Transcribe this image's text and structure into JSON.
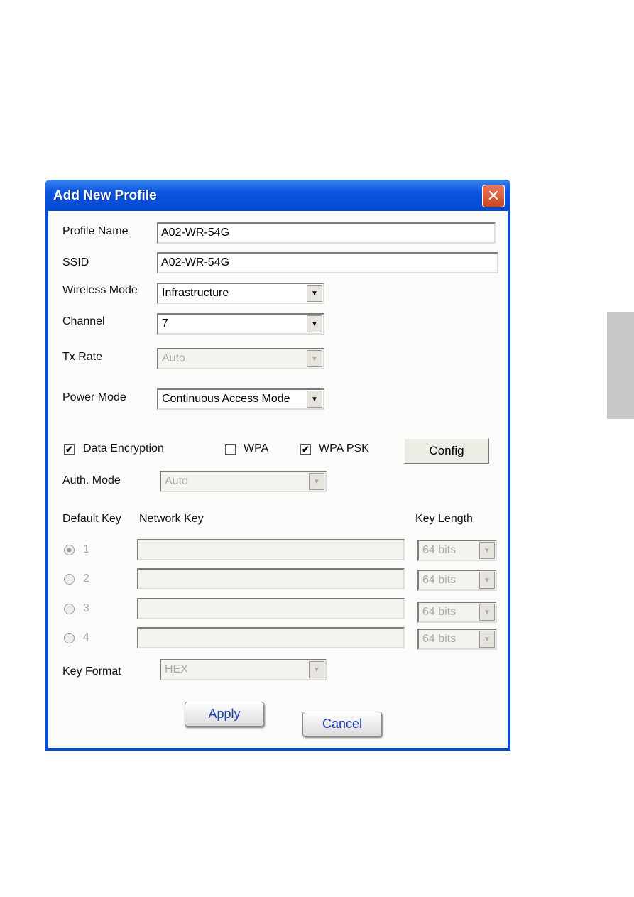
{
  "dialog": {
    "title": "Add New Profile",
    "close": "✕"
  },
  "fields": {
    "profile_name": {
      "label": "Profile Name",
      "value": "A02-WR-54G"
    },
    "ssid": {
      "label": "SSID",
      "value": "A02-WR-54G"
    },
    "wireless_mode": {
      "label": "Wireless Mode",
      "value": "Infrastructure"
    },
    "channel": {
      "label": "Channel",
      "value": "7"
    },
    "tx_rate": {
      "label": "Tx Rate",
      "value": "Auto"
    },
    "power_mode": {
      "label": "Power Mode",
      "value": "Continuous Access Mode"
    }
  },
  "security": {
    "data_encryption": {
      "label": "Data Encryption",
      "checked": true
    },
    "wpa": {
      "label": "WPA",
      "checked": false
    },
    "wpa_psk": {
      "label": "WPA PSK",
      "checked": true
    },
    "config_label": "Config",
    "auth_mode": {
      "label": "Auth. Mode",
      "value": "Auto"
    }
  },
  "keys": {
    "headers": {
      "default_key": "Default Key",
      "network_key": "Network Key",
      "key_length": "Key Length"
    },
    "rows": [
      {
        "num": "1",
        "value": "",
        "length": "64 bits",
        "selected": true
      },
      {
        "num": "2",
        "value": "",
        "length": "64 bits",
        "selected": false
      },
      {
        "num": "3",
        "value": "",
        "length": "64 bits",
        "selected": false
      },
      {
        "num": "4",
        "value": "",
        "length": "64 bits",
        "selected": false
      }
    ],
    "format": {
      "label": "Key Format",
      "value": "HEX"
    }
  },
  "buttons": {
    "apply": "Apply",
    "cancel": "Cancel"
  },
  "check": "✔",
  "arrow": "▼"
}
